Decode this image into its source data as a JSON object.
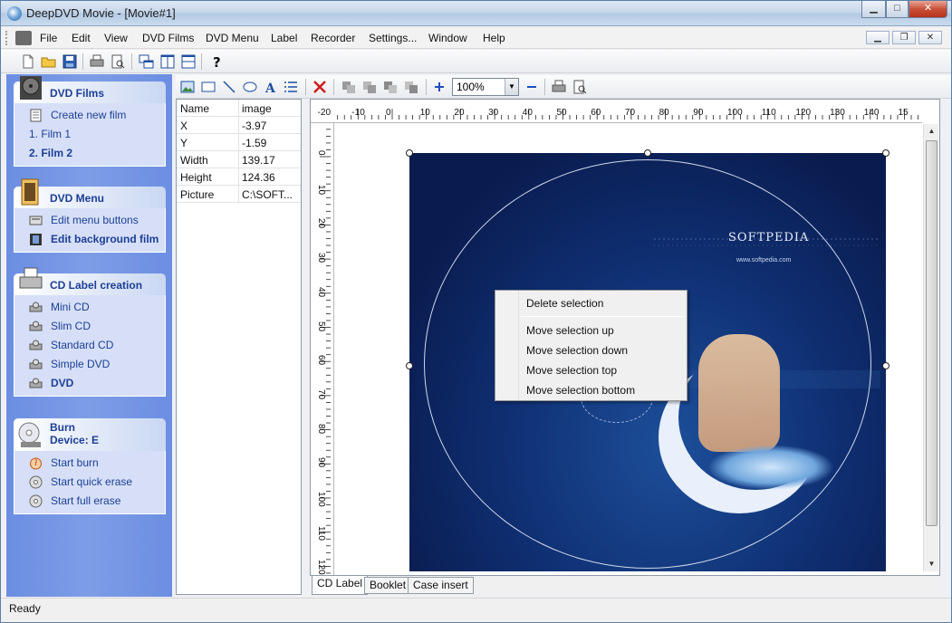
{
  "window": {
    "title": "DeepDVD Movie - [Movie#1]"
  },
  "menu": [
    "File",
    "Edit",
    "View",
    "DVD Films",
    "DVD Menu",
    "Label",
    "Recorder",
    "Settings...",
    "Window",
    "Help"
  ],
  "sidebar": {
    "dvd_films": {
      "title": "DVD Films",
      "items": [
        "Create new film",
        "1. Film 1",
        "2. Film 2"
      ]
    },
    "dvd_menu": {
      "title": "DVD Menu",
      "items": [
        "Edit menu buttons",
        "Edit background film"
      ]
    },
    "cd_label": {
      "title": "CD Label creation",
      "items": [
        "Mini CD",
        "Slim CD",
        "Standard CD",
        "Simple DVD",
        "DVD"
      ]
    },
    "burn": {
      "title": "Burn",
      "subtitle": "Device: E",
      "items": [
        "Start burn",
        "Start quick erase",
        "Start full erase"
      ]
    }
  },
  "properties": [
    {
      "name": "Name",
      "value": "image"
    },
    {
      "name": "X",
      "value": "-3.97"
    },
    {
      "name": "Y",
      "value": "-1.59"
    },
    {
      "name": "Width",
      "value": "139.17"
    },
    {
      "name": "Height",
      "value": "124.36"
    },
    {
      "name": "Picture",
      "value": "C:\\SOFT..."
    }
  ],
  "zoom": "100%",
  "ruler": {
    "h": [
      "-20",
      "-10",
      "0",
      "10",
      "20",
      "30",
      "40",
      "50",
      "60",
      "70",
      "80",
      "90",
      "100",
      "110",
      "120",
      "130",
      "140",
      "15"
    ],
    "v": [
      "0",
      "10",
      "20",
      "30",
      "40",
      "50",
      "60",
      "70",
      "80",
      "90",
      "100",
      "110",
      "120"
    ]
  },
  "artwork": {
    "watermark": "SOFTPEDIA",
    "url": "www.softpedia.com"
  },
  "context_menu": [
    "Delete selection",
    "Move selection up",
    "Move selection down",
    "Move selection top",
    "Move selection bottom"
  ],
  "tabs": [
    "CD Label",
    "Booklet",
    "Case insert"
  ],
  "status": "Ready"
}
